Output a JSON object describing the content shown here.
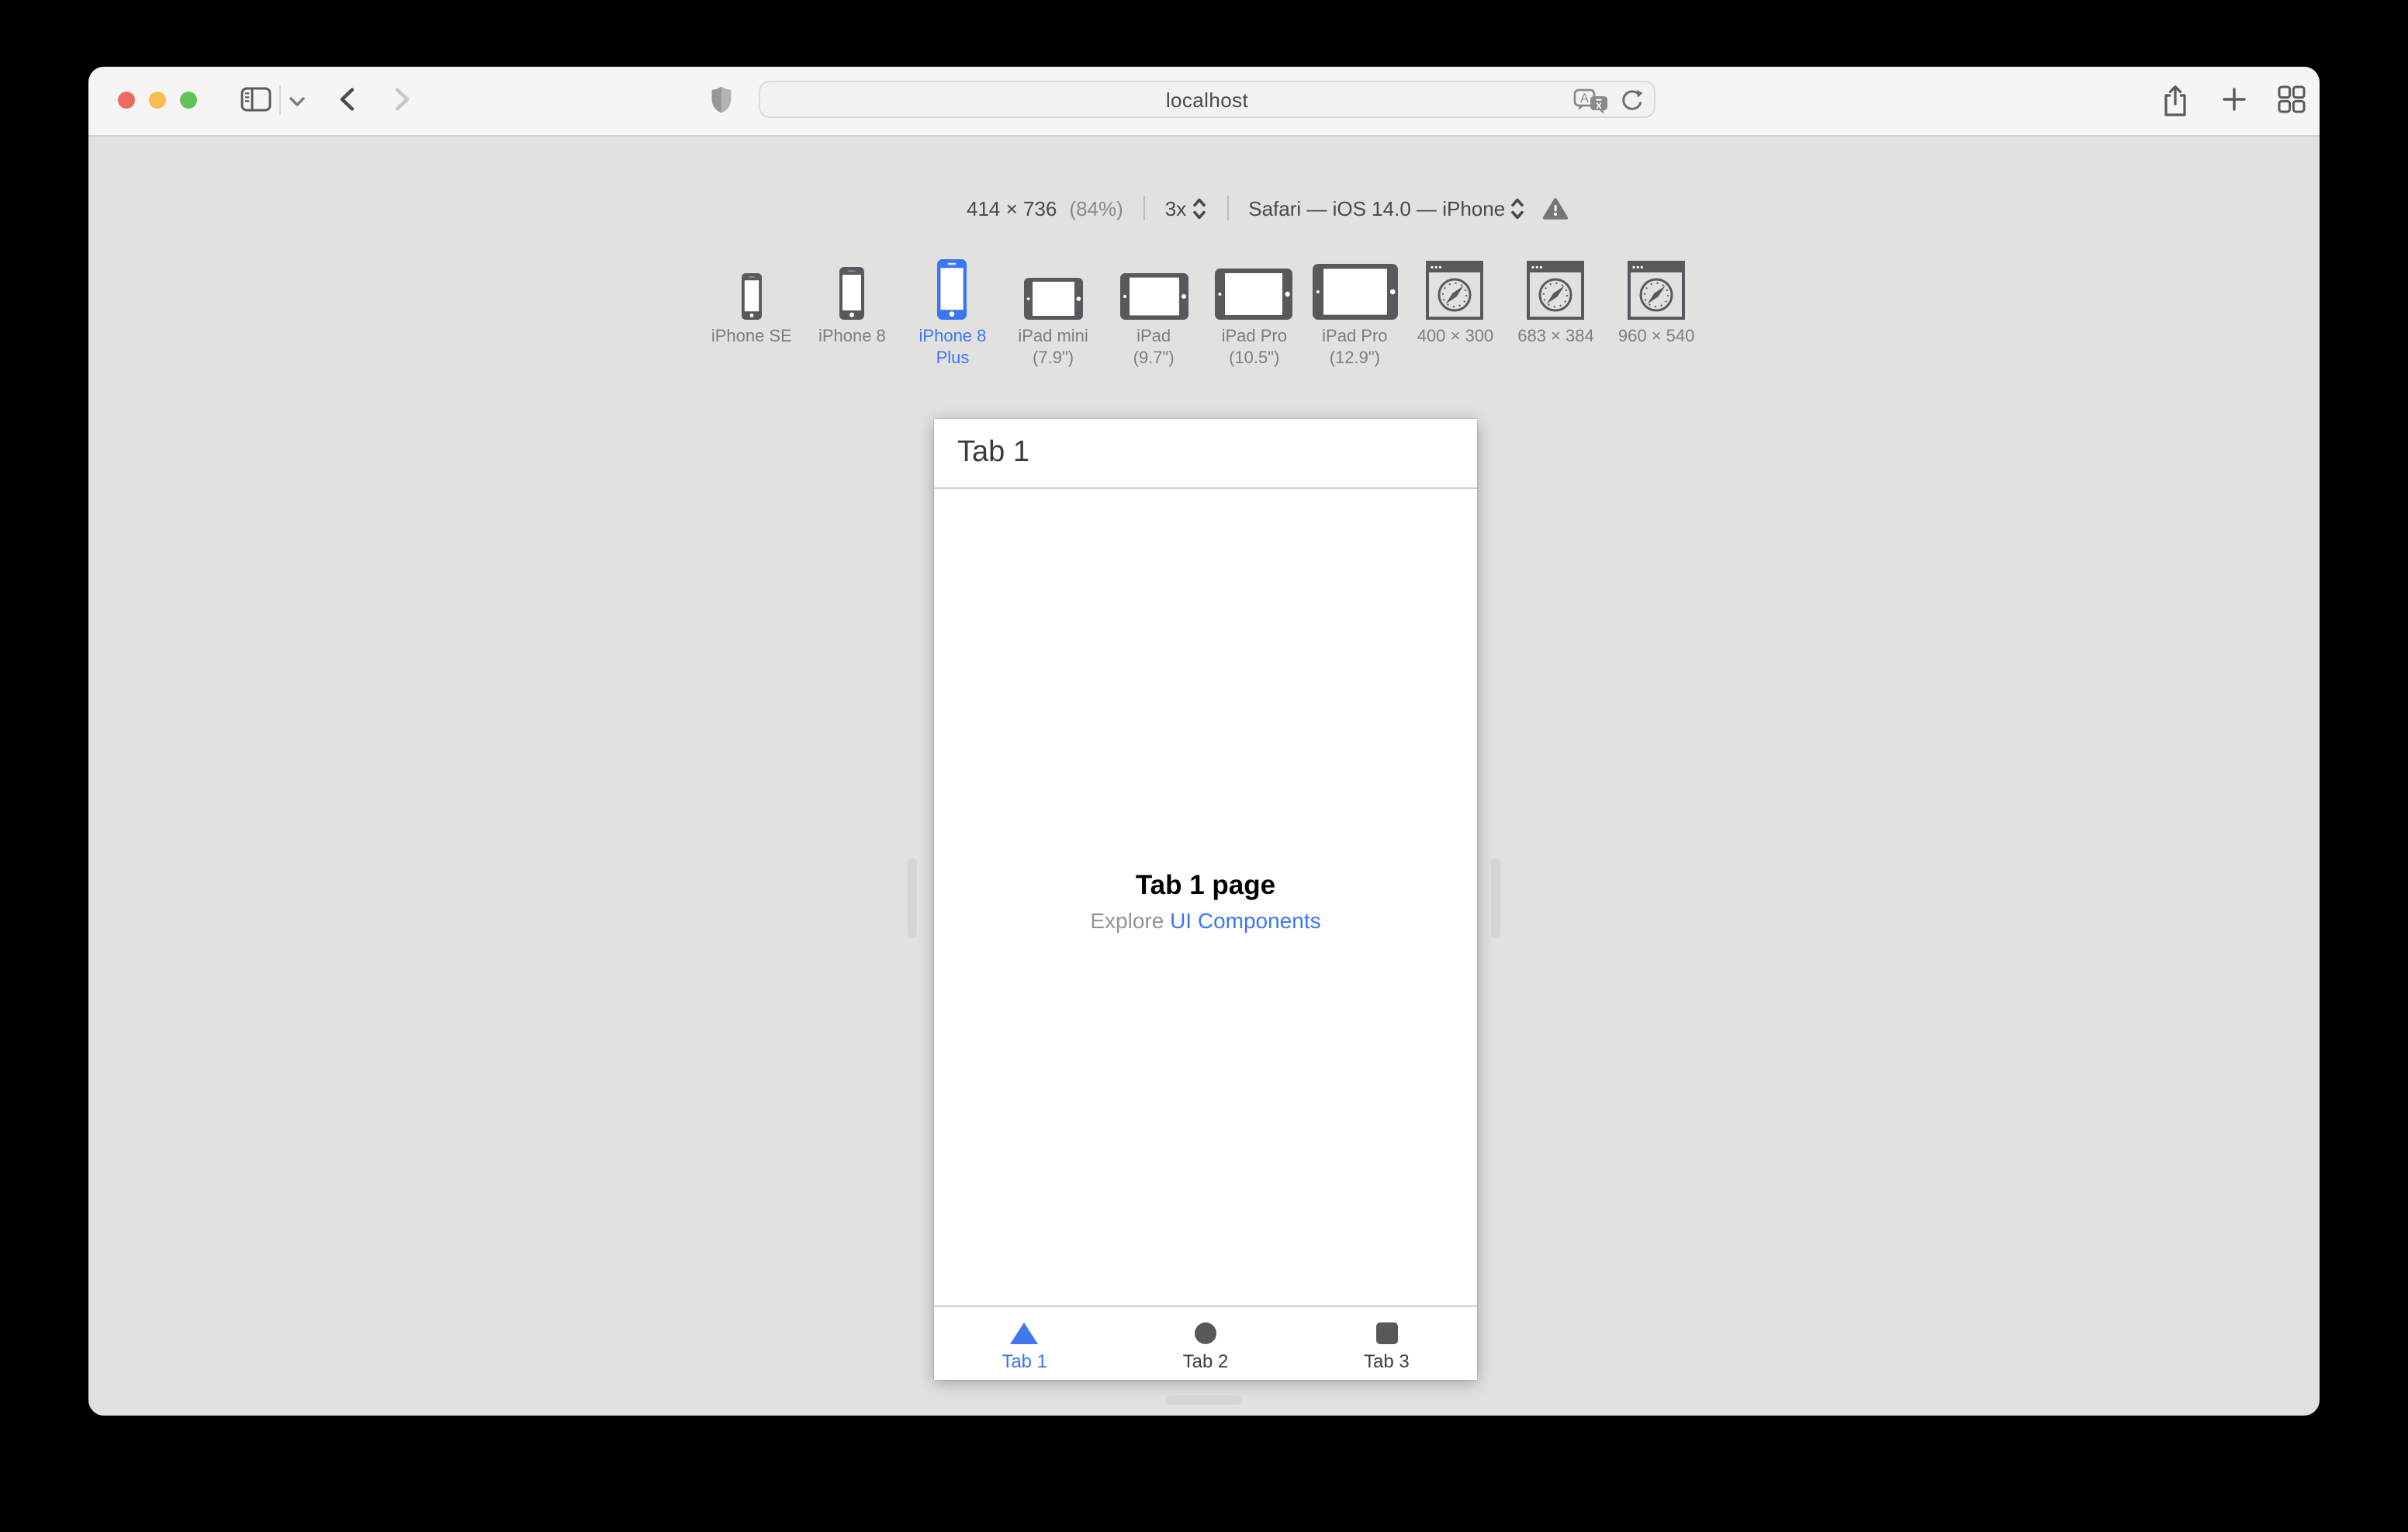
{
  "titlebar": {
    "url": "localhost"
  },
  "rdm_toolbar": {
    "size": "414 × 736",
    "zoom": "(84%)",
    "pixel_ratio": "3x",
    "user_agent": "Safari — iOS 14.0 — iPhone"
  },
  "devices": [
    {
      "line1": "iPhone SE",
      "line2": "",
      "selected": false
    },
    {
      "line1": "iPhone 8",
      "line2": "",
      "selected": false
    },
    {
      "line1": "iPhone 8",
      "line2": "Plus",
      "selected": true
    },
    {
      "line1": "iPad mini",
      "line2": "(7.9\")",
      "selected": false
    },
    {
      "line1": "iPad",
      "line2": "(9.7\")",
      "selected": false
    },
    {
      "line1": "iPad Pro",
      "line2": "(10.5\")",
      "selected": false
    },
    {
      "line1": "iPad Pro",
      "line2": "(12.9\")",
      "selected": false
    },
    {
      "line1": "400 × 300",
      "line2": "",
      "selected": false
    },
    {
      "line1": "683 × 384",
      "line2": "",
      "selected": false
    },
    {
      "line1": "960 × 540",
      "line2": "",
      "selected": false
    }
  ],
  "preview": {
    "navbar_title": "Tab 1",
    "page_title": "Tab 1 page",
    "explore_text": "Explore ",
    "explore_link": "UI Components",
    "tabs": [
      {
        "label": "Tab 1",
        "shape": "triangle",
        "active": true
      },
      {
        "label": "Tab 2",
        "shape": "circle",
        "active": false
      },
      {
        "label": "Tab 3",
        "shape": "square",
        "active": false
      }
    ]
  },
  "colors": {
    "accent_blue": "#3b76f3",
    "device_gray": "#59585c",
    "window_bg": "#e2e1e0",
    "toolbar_bg": "#f6f5f3"
  }
}
